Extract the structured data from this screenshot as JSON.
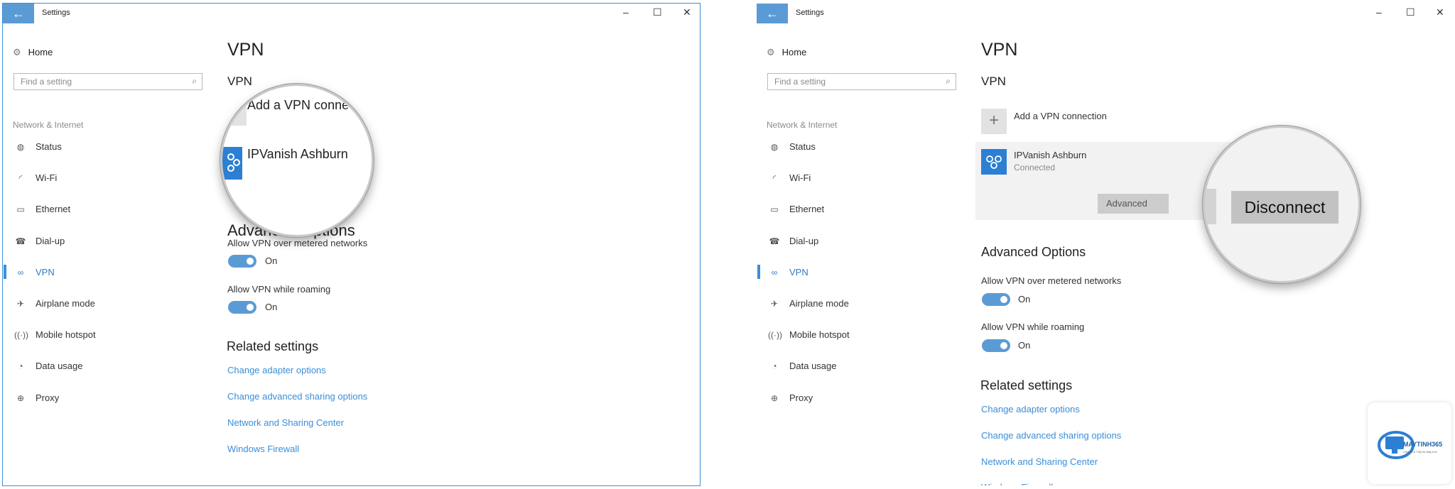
{
  "window": {
    "title": "Settings",
    "back_icon": "arrow-left-icon",
    "minimize": "–",
    "maximize": "☐",
    "close": "✕"
  },
  "sidebar": {
    "home": "Home",
    "search_placeholder": "Find a setting",
    "section": "Network & Internet",
    "items": [
      {
        "label": "Status",
        "icon": "globe-status-icon"
      },
      {
        "label": "Wi-Fi",
        "icon": "wifi-icon"
      },
      {
        "label": "Ethernet",
        "icon": "ethernet-icon"
      },
      {
        "label": "Dial-up",
        "icon": "dialup-icon"
      },
      {
        "label": "VPN",
        "icon": "vpn-icon",
        "active": true
      },
      {
        "label": "Airplane mode",
        "icon": "airplane-icon"
      },
      {
        "label": "Mobile hotspot",
        "icon": "hotspot-icon"
      },
      {
        "label": "Data usage",
        "icon": "data-usage-icon"
      },
      {
        "label": "Proxy",
        "icon": "proxy-globe-icon"
      }
    ]
  },
  "main": {
    "page_title": "VPN",
    "vpn_heading": "VPN",
    "add_vpn": "Add a VPN connection",
    "add_vpn_left_magnified": "Add a VPN conne",
    "vpn_name": "IPVanish Ashburn",
    "vpn_status": "Connected",
    "advanced_button": "Advanced",
    "disconnect_button": "Disconnect",
    "advanced_heading": "Advanced Options",
    "advanced_heading_left": "Advanced Options",
    "metered_label": "Allow VPN over metered networks",
    "metered_state": "On",
    "roaming_label": "Allow VPN while roaming",
    "roaming_state": "On",
    "related_heading": "Related settings",
    "links": [
      "Change adapter options",
      "Change advanced sharing options",
      "Network and Sharing Center",
      "Windows Firewall"
    ]
  },
  "watermark": {
    "brand": "MAYTINH365",
    "tagline": "Chia sẻ & Tiếp thị Máy tính"
  },
  "colors": {
    "accent": "#3a8ed8",
    "toggle_on": "#5b9bd5",
    "vpn_tile": "#2c7fd2"
  }
}
